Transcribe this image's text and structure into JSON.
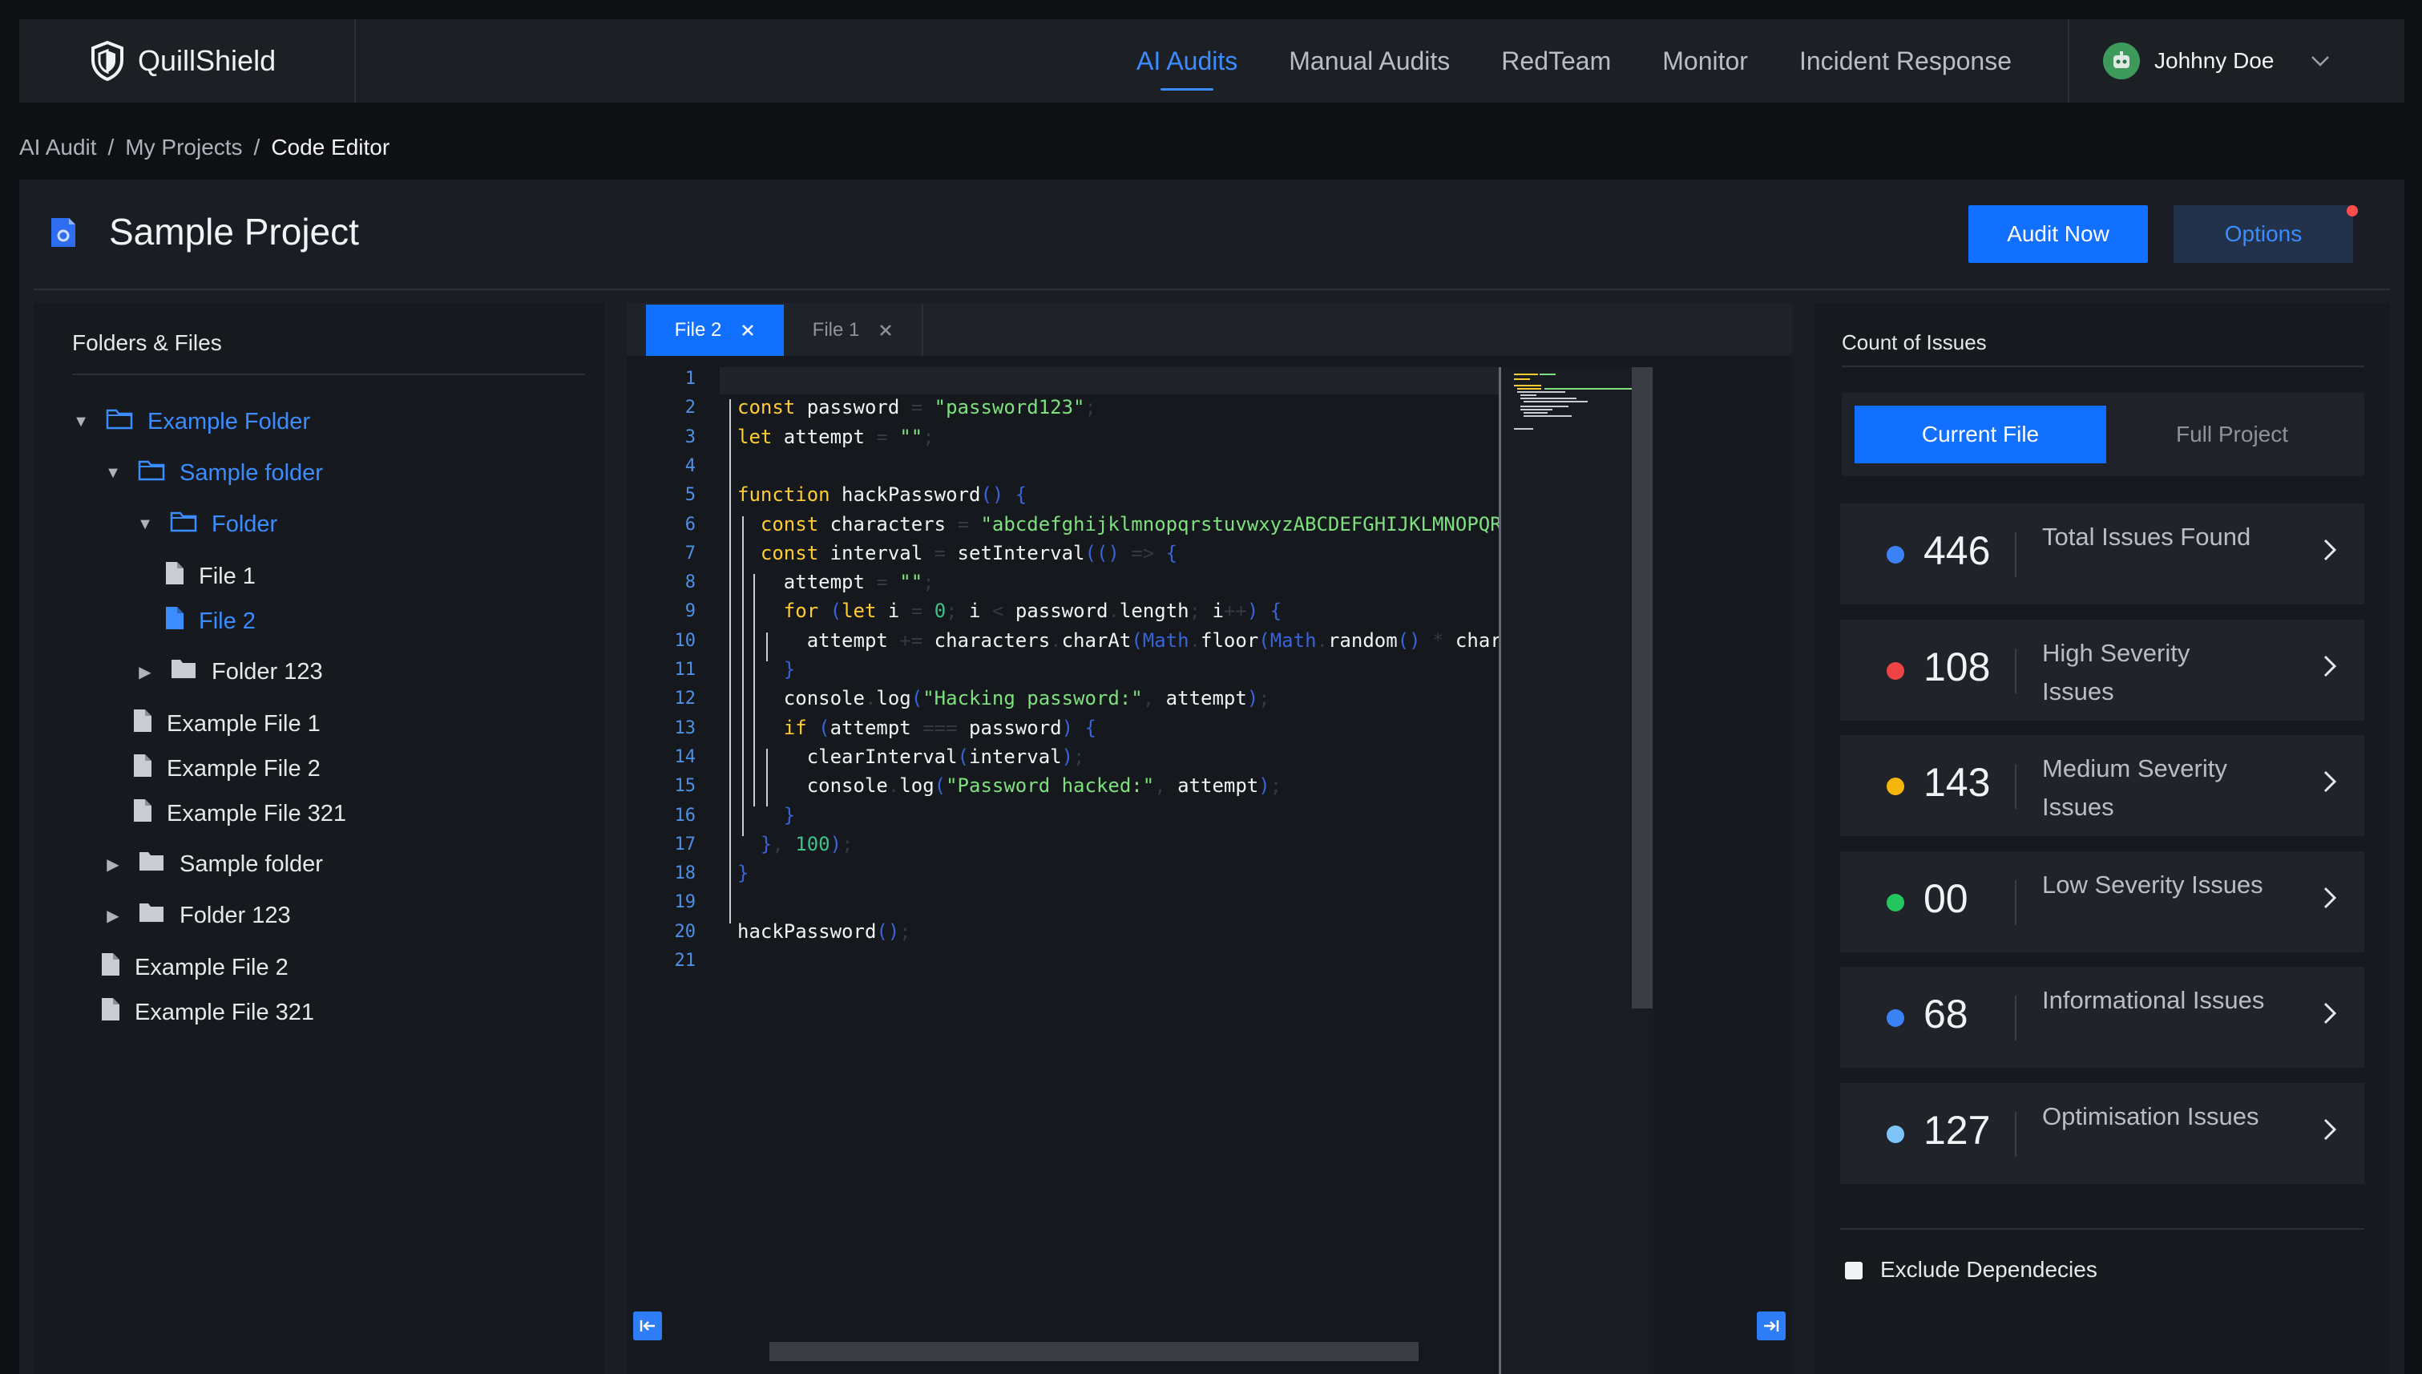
{
  "app": {
    "brand": "QuillShield",
    "nav": [
      "AI Audits",
      "Manual Audits",
      "RedTeam",
      "Monitor",
      "Incident Response"
    ],
    "active_nav": "AI Audits",
    "user": {
      "name": "Johhny Doe",
      "avatar_icon": "robot-avatar-icon"
    }
  },
  "breadcrumb": [
    "AI Audit",
    "My Projects",
    "Code Editor"
  ],
  "project": {
    "title": "Sample Project",
    "audit_button": "Audit Now",
    "options_button": "Options"
  },
  "files_panel": {
    "title": "Folders & Files",
    "tree": [
      {
        "label": "Example Folder",
        "type": "folder-open",
        "selected": true
      },
      {
        "label": "Sample folder",
        "type": "folder-open",
        "selected": true
      },
      {
        "label": "Folder",
        "type": "folder-open",
        "selected": true
      },
      {
        "label": "File 1",
        "type": "file",
        "selected": false
      },
      {
        "label": "File 2",
        "type": "file",
        "selected": true
      },
      {
        "label": "Folder 123",
        "type": "folder-closed",
        "selected": false
      },
      {
        "label": "Example File 1",
        "type": "file",
        "selected": false
      },
      {
        "label": "Example File 2",
        "type": "file",
        "selected": false
      },
      {
        "label": "Example File 321",
        "type": "file",
        "selected": false
      },
      {
        "label": "Sample folder",
        "type": "folder-closed",
        "selected": false
      },
      {
        "label": "Folder 123",
        "type": "folder-closed",
        "selected": false
      },
      {
        "label": "Example File 2",
        "type": "file",
        "selected": false
      },
      {
        "label": "Example File 321",
        "type": "file",
        "selected": false
      }
    ]
  },
  "editor": {
    "tabs": [
      "File 2",
      "File 1"
    ],
    "active_tab": "File 2",
    "line_numbers": [
      "1",
      "2",
      "3",
      "4",
      "5",
      "6",
      "7",
      "8",
      "9",
      "10",
      "11",
      "12",
      "13",
      "14",
      "15",
      "16",
      "17",
      "18",
      "19",
      "20",
      "21"
    ],
    "code": [
      "",
      "const password = \"password123\";",
      "let attempt = \"\";",
      "",
      "function hackPassword() {",
      "  const characters = \"abcdefghijklmnopqrstuvwxyzABCDEFGHIJKLMNOPQRSTUVWXYZ",
      "  const interval = setInterval(() => {",
      "    attempt = \"\";",
      "    for (let i = 0; i < password.length; i++) {",
      "      attempt += characters.charAt(Math.floor(Math.random() * characters.l",
      "    }",
      "    console.log(\"Hacking password:\", attempt);",
      "    if (attempt === password) {",
      "      clearInterval(interval);",
      "      console.log(\"Password hacked:\", attempt);",
      "    }",
      "  }, 100);",
      "}",
      "",
      "hackPassword();",
      ""
    ]
  },
  "issues_panel": {
    "title": "Count of Issues",
    "toggle": [
      "Current File",
      "Full Project"
    ],
    "active_toggle": "Current File",
    "cards": [
      {
        "count": "446",
        "label": "Total Issues Found",
        "color": "#3b82f6"
      },
      {
        "count": "108",
        "label": "High Severity Issues",
        "color": "#ef4444"
      },
      {
        "count": "143",
        "label": "Medium Severity Issues",
        "color": "#f5b50a"
      },
      {
        "count": "00",
        "label": "Low Severity Issues",
        "color": "#22c55e"
      },
      {
        "count": "68",
        "label": "Informational Issues",
        "color": "#3b82f6"
      },
      {
        "count": "127",
        "label": "Optimisation Issues",
        "color": "#7cc4fa"
      }
    ],
    "exclude_label": "Exclude Dependecies"
  }
}
